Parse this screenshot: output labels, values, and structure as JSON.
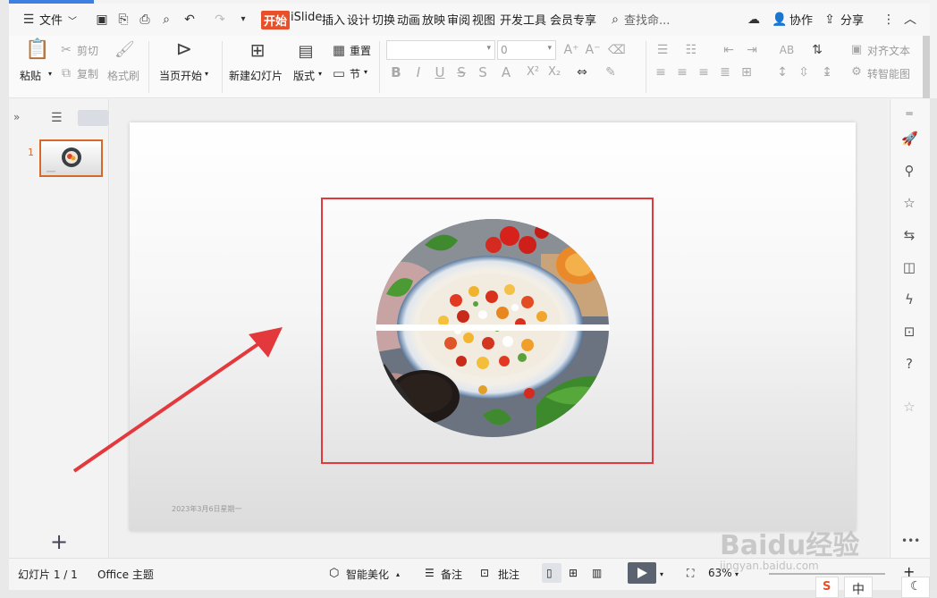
{
  "menubar": {
    "file_label": "文件",
    "tabs": [
      "开始",
      "iSlide",
      "插入",
      "设计",
      "切换",
      "动画",
      "放映",
      "审阅",
      "视图",
      "开发工具",
      "会员专享"
    ],
    "active_tab": "开始",
    "search_label": "查找命...",
    "collab_label": "协作",
    "share_label": "分享"
  },
  "ribbon": {
    "paste": "粘贴",
    "cut": "剪切",
    "copy": "复制",
    "format_painter": "格式刷",
    "from_current": "当页开始",
    "new_slide": "新建幻灯片",
    "layout": "版式",
    "reset": "重置",
    "section": "节",
    "font_size": "0",
    "align_text": "对齐文本",
    "smart_convert": "转智能图"
  },
  "thumbnails": {
    "slide_number": "1"
  },
  "slide": {
    "date_text": "2023年3月6日星期一"
  },
  "statusbar": {
    "slide_info": "幻灯片 1 / 1",
    "theme": "Office 主题",
    "smart_beautify": "智能美化",
    "notes": "备注",
    "comments": "批注",
    "zoom": "63%"
  },
  "watermark": {
    "brand": "Baidu经验",
    "url": "jingyan.baidu.com"
  },
  "taskbar": {
    "ime": "中"
  },
  "colors": {
    "accent": "#e8502c",
    "highlight_box": "#e4393c",
    "arrow": "#e4393c",
    "thumb_border": "#d46a27"
  }
}
